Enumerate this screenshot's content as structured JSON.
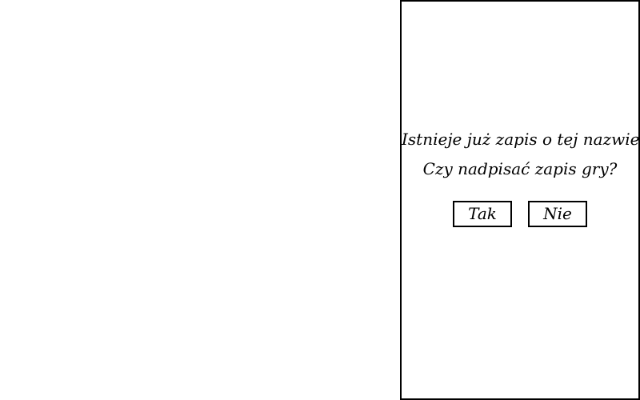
{
  "dialog": {
    "message_line_1": "Istnieje już zapis o tej nazwie.",
    "message_line_2": "Czy nadpisać zapis gry?",
    "yes_label": "Tak",
    "no_label": "Nie"
  },
  "colors": {
    "background": "#ffffff",
    "border": "#000000",
    "text": "#000000"
  }
}
